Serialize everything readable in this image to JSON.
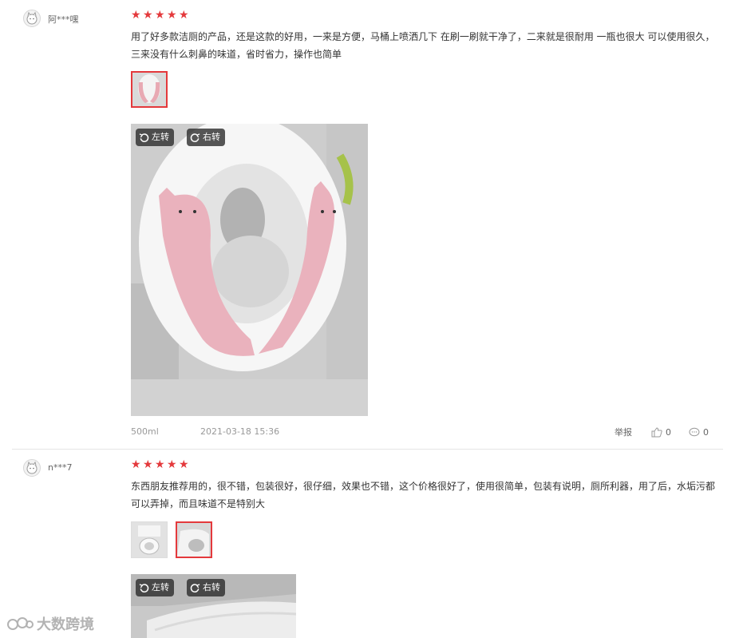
{
  "reviews": [
    {
      "username": "阿***嘿",
      "rating": 5,
      "content": "用了好多款洁厕的产品，还是这款的好用，一来是方便，马桶上喷洒几下 在刷一刷就干净了，二来就是很耐用 一瓶也很大 可以使用很久，三来没有什么刺鼻的味道，省时省力，操作也简单",
      "rotate_left": "左转",
      "rotate_right": "右转",
      "spec": "500ml",
      "date": "2021-03-18 15:36",
      "report": "举报",
      "likes": "0",
      "replies": "0"
    },
    {
      "username": "n***7",
      "rating": 5,
      "content": "东西朋友推荐用的，很不错，包装很好，很仔细，效果也不错，这个价格很好了，使用很简单，包装有说明，厕所利器，用了后，水垢污都可以弄掉，而且味道不是特别大",
      "rotate_left": "左转",
      "rotate_right": "右转"
    }
  ],
  "watermark": "大数跨境",
  "colors": {
    "accent": "#e4393c",
    "divider": "#e5e5e5",
    "meta": "#999999"
  },
  "icons": [
    "user-avatar-icon",
    "star-icon",
    "rotate-left-icon",
    "rotate-right-icon",
    "thumbs-up-icon",
    "comment-icon"
  ]
}
